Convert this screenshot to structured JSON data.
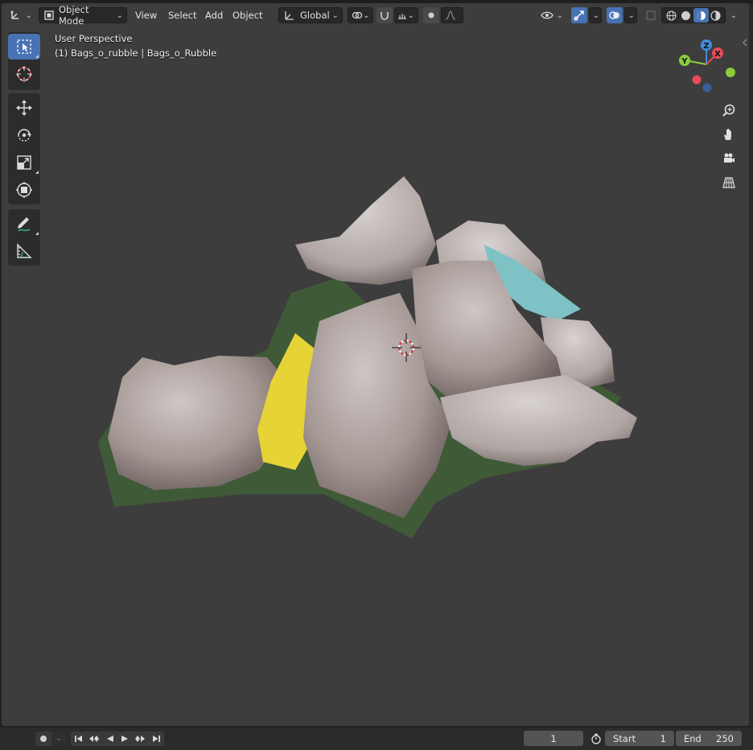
{
  "header": {
    "mode_label": "Object Mode",
    "menus": [
      "View",
      "Select",
      "Add",
      "Object"
    ],
    "orientation_label": "Global"
  },
  "overlay": {
    "perspective": "User Perspective",
    "object_info": "(1) Bags_o_rubble | Bags_o_Rubble"
  },
  "toolbar": {
    "tools": [
      "select-box",
      "cursor",
      "move",
      "rotate",
      "scale",
      "transform",
      "annotate",
      "measure"
    ]
  },
  "gizmo": {
    "z": "Z",
    "x": "X",
    "y": "Y"
  },
  "nav_buttons": [
    "zoom-icon",
    "hand-icon",
    "camera-icon",
    "grid-icon"
  ],
  "timeline": {
    "current_frame": "1",
    "start_label": "Start",
    "start_value": "1",
    "end_label": "End",
    "end_value": "250"
  },
  "colors": {
    "viewport_bg": "#3d3d3d",
    "accent": "#4772b3",
    "gizmo_x": "#e84a5a",
    "gizmo_y": "#8ccc3c",
    "gizmo_z": "#3f8ee0"
  }
}
